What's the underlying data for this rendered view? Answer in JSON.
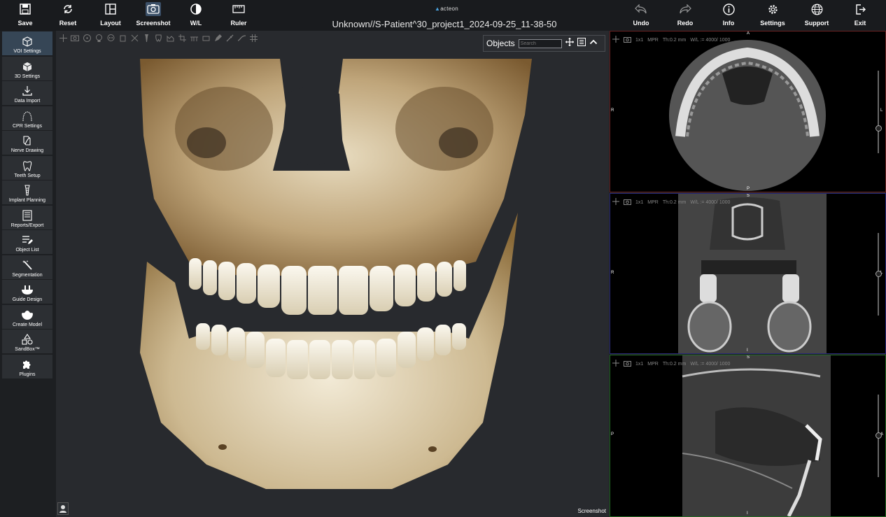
{
  "app": {
    "brand": "acteon",
    "title": "Unknown//S-Patient^30_project1_2024-09-25_11-38-50"
  },
  "toolbar_left": [
    {
      "label": "Save",
      "icon": "save-icon"
    },
    {
      "label": "Reset",
      "icon": "reset-icon"
    },
    {
      "label": "Layout",
      "icon": "layout-icon"
    },
    {
      "label": "Screenshot",
      "icon": "camera-icon"
    },
    {
      "label": "W/L",
      "icon": "contrast-icon"
    },
    {
      "label": "Ruler",
      "icon": "ruler-icon"
    }
  ],
  "toolbar_right": [
    {
      "label": "Undo",
      "icon": "undo-icon"
    },
    {
      "label": "Redo",
      "icon": "redo-icon"
    },
    {
      "label": "Info",
      "icon": "info-icon"
    },
    {
      "label": "Settings",
      "icon": "gear-icon"
    },
    {
      "label": "Support",
      "icon": "globe-icon"
    },
    {
      "label": "Exit",
      "icon": "exit-icon"
    }
  ],
  "sidebar": [
    {
      "label": "VOI Settings",
      "icon": "voi-cube-icon",
      "active": true
    },
    {
      "label": "3D Settings",
      "icon": "3d-cube-icon"
    },
    {
      "label": "Data Import",
      "icon": "download-icon"
    },
    {
      "label": "CPR Settings",
      "icon": "arch-curve-icon"
    },
    {
      "label": "Nerve Drawing",
      "icon": "nerve-icon"
    },
    {
      "label": "Teeth Setup",
      "icon": "tooth-icon"
    },
    {
      "label": "Implant Planning",
      "icon": "implant-icon"
    },
    {
      "label": "Reports/Export",
      "icon": "report-icon"
    },
    {
      "label": "Object List",
      "icon": "list-edit-icon"
    },
    {
      "label": "Segmentation",
      "icon": "magic-wand-icon"
    },
    {
      "label": "Guide Design",
      "icon": "guide-icon"
    },
    {
      "label": "Create Model",
      "icon": "model-icon"
    },
    {
      "label": "SandBox™",
      "icon": "shapes-icon"
    },
    {
      "label": "Plugins",
      "icon": "puzzle-icon"
    }
  ],
  "view3d": {
    "objects_label": "Objects",
    "search_placeholder": "Search",
    "screenshot_label": "Screenshot"
  },
  "panels": [
    {
      "name": "axial",
      "layout": "1x1",
      "mode": "MPR",
      "thickness": "Th:0.2 mm",
      "wl": "W/L := 4000/ 1000",
      "orient_top": "A",
      "orient_bottom": "P",
      "orient_left": "R",
      "orient_right": "L",
      "border": "#8a2a2a"
    },
    {
      "name": "coronal",
      "layout": "1x1",
      "mode": "MPR",
      "thickness": "Th:0.2 mm",
      "wl": "W/L := 4000/ 1000",
      "orient_top": "S",
      "orient_bottom": "I",
      "orient_left": "R",
      "orient_right": "L",
      "border": "#3a3a9a"
    },
    {
      "name": "sagittal",
      "layout": "1x1",
      "mode": "MPR",
      "thickness": "Th:0.2 mm",
      "wl": "W/L := 4000/ 1000",
      "orient_top": "S",
      "orient_bottom": "I",
      "orient_left": "P",
      "orient_right": "A",
      "border": "#2a7a2a"
    }
  ]
}
